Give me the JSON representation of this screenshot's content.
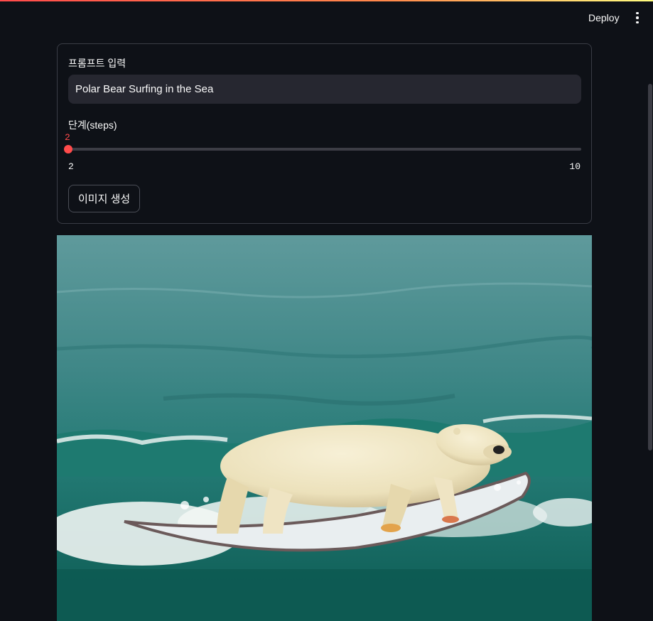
{
  "header": {
    "deploy_label": "Deploy",
    "menu_icon": "vertical-ellipsis-icon"
  },
  "form": {
    "prompt_label": "프롬프트 입력",
    "prompt_value": "Polar Bear Surfing in the Sea",
    "steps_label": "단계(steps)",
    "steps_value": "2",
    "steps_min": "2",
    "steps_max": "10",
    "generate_label": "이미지 생성"
  },
  "theme": {
    "background": "#0e1117",
    "accent": "#ff4b4b",
    "input_background": "#262730"
  }
}
